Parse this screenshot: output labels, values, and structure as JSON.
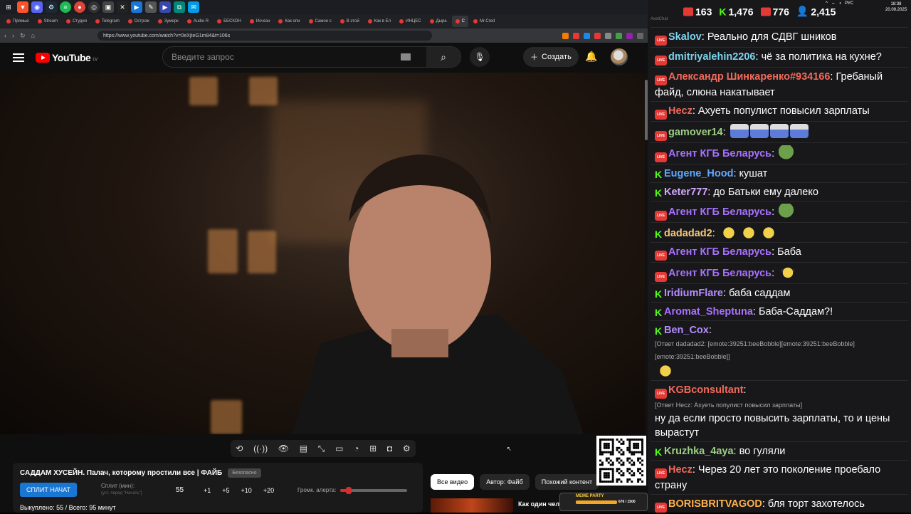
{
  "browser": {
    "tabs": [
      {
        "label": "Прямые"
      },
      {
        "label": "Stream"
      },
      {
        "label": "Студия"
      },
      {
        "label": "Telegram"
      },
      {
        "label": "Острож"
      },
      {
        "label": "Зумерк"
      },
      {
        "label": "Audio R"
      },
      {
        "label": "БЕСКОН"
      },
      {
        "label": "Исчезн"
      },
      {
        "label": "Как опи"
      },
      {
        "label": "Самое с"
      },
      {
        "label": "В этой"
      },
      {
        "label": "Как в Ел"
      },
      {
        "label": "ИНЦЕС"
      },
      {
        "label": "Дыра"
      },
      {
        "label": "С"
      },
      {
        "label": "Mr.Cred"
      }
    ],
    "url": "https://www.youtube.com/watch?v=0eXjteG1m84&t=106s"
  },
  "youtube": {
    "logo": "YouTube",
    "country": "LV",
    "search_placeholder": "Введите запрос",
    "create_label": "Создать"
  },
  "overlay": {
    "video_title": "САДДАМ ХУСЕЙН. Палач, которому простили все | ФАЙБ",
    "badge": "Безопасно",
    "split_button": "СПЛИТ НАЧАТ",
    "split_label": "Сплит (мин):",
    "split_hint": "(уст. перед \"Начать\")",
    "split_value": "55",
    "increments": [
      "+1",
      "+5",
      "+10",
      "+20"
    ],
    "alert_volume_label": "Громк. алерта:",
    "alert_volume": 0.12,
    "bought": "Выкуплено: 55 / Всего: 95 минут"
  },
  "chips": [
    "Все видео",
    "Автор: Файб",
    "Похожий контент"
  ],
  "recommendation": {
    "title": "Как один чел"
  },
  "meme_party": {
    "title": "MEME PARTY",
    "progress_text": "676 / 1500"
  },
  "chat": {
    "stats": {
      "youtube_likes": "163",
      "kick": "1,476",
      "live": "776",
      "viewers": "2,415"
    },
    "title": "AxelChat",
    "messages": [
      {
        "platform": "yt",
        "user": "Skalov",
        "color": "#7bd3ec",
        "text": "Реально для СДВГ шников"
      },
      {
        "platform": "yt",
        "user": "dmitriyalehin2206",
        "color": "#7bd3ec",
        "text": "чё за политика на кухне?"
      },
      {
        "platform": "yt",
        "user": "Александр Шинкаренко#934166",
        "color": "#f26a5a",
        "text": "Гребаный файд, слюна накатывает"
      },
      {
        "platform": "yt",
        "user": "Hecz",
        "color": "#f26a5a",
        "text": "Ахуеть популист повысил зарплаты"
      },
      {
        "platform": "yt",
        "user": "gamover14",
        "color": "#9bcf83",
        "text": "",
        "emote": "cat"
      },
      {
        "platform": "yt",
        "user": "Агент КГБ Беларусь",
        "color": "#a970ff",
        "text": "",
        "emote": "frog"
      },
      {
        "platform": "kick",
        "user": "Eugene_Hood",
        "color": "#5fa8ff",
        "text": "кушат"
      },
      {
        "platform": "kick",
        "user": "Keter777",
        "color": "#d6a9ff",
        "text": "до Батьки ему далеко"
      },
      {
        "platform": "yt",
        "user": "Агент КГБ Беларусь",
        "color": "#a970ff",
        "text": "",
        "emote": "frog"
      },
      {
        "platform": "kick",
        "user": "dadadad2",
        "color": "#f5c97a",
        "text": "",
        "emote": "bob"
      },
      {
        "platform": "yt",
        "user": "Агент КГБ Беларусь",
        "color": "#a970ff",
        "text": "Баба"
      },
      {
        "platform": "yt",
        "user": "Агент КГБ Беларусь",
        "color": "#a970ff",
        "text": "",
        "emote": "cool"
      },
      {
        "platform": "kick",
        "user": "IridiumFlare",
        "color": "#b58cff",
        "text": "баба саддам"
      },
      {
        "platform": "kick",
        "user": "Aromat_Sheptuna",
        "color": "#a970ff",
        "text": "Баба-Саддам?!"
      },
      {
        "platform": "kick",
        "user": "Ben_Cox",
        "color": "#b58cff",
        "text": "",
        "reply": "[Ответ dadadad2: [emote:39251:beeBobble][emote:39251:beeBobble][emote:39251:beeBobble]]",
        "emote": "bob"
      },
      {
        "platform": "yt",
        "user": "KGBconsultant",
        "color": "#f26a5a",
        "text": "ну да если просто повысить зарплаты, то и цены вырастут",
        "reply": "[Ответ Hecz: Ахуеть популист повысил зарплаты]"
      },
      {
        "platform": "kick",
        "user": "Kruzhka_4aya",
        "color": "#9bcf83",
        "text": "во гуляли"
      },
      {
        "platform": "yt",
        "user": "Hecz",
        "color": "#f26a5a",
        "text": "Через 20 лет это поколение проебало страну"
      },
      {
        "platform": "yt",
        "user": "BORISBRITVAGOD",
        "color": "#ffb14a",
        "text": "бля торт захотелось"
      }
    ]
  },
  "systray": {
    "lang": "РУС",
    "time": "18:38",
    "date": "20.09.2025"
  }
}
